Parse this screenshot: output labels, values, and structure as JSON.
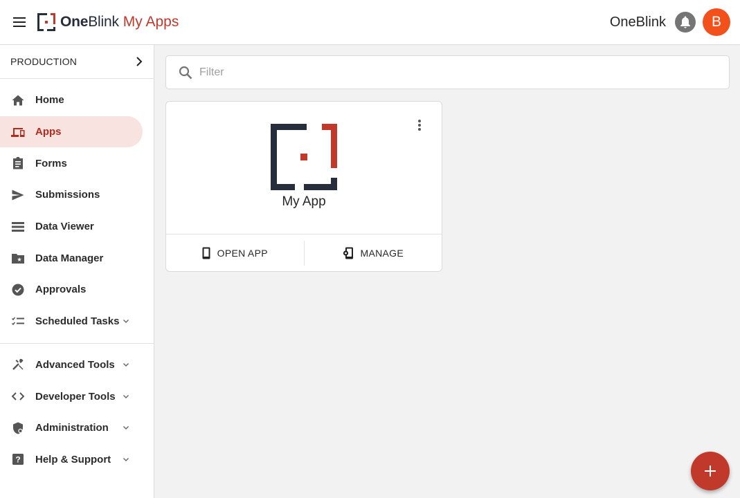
{
  "header": {
    "brand_name_bold": "One",
    "brand_name_light": "Blink",
    "brand_subtitle": "My Apps",
    "organization": "OneBlink",
    "avatar_initial": "B"
  },
  "sidebar": {
    "environment": "PRODUCTION",
    "items": [
      {
        "label": "Home",
        "icon": "home-icon"
      },
      {
        "label": "Apps",
        "icon": "devices-icon",
        "active": true
      },
      {
        "label": "Forms",
        "icon": "clipboard-icon"
      },
      {
        "label": "Submissions",
        "icon": "send-icon"
      },
      {
        "label": "Data Viewer",
        "icon": "list-icon"
      },
      {
        "label": "Data Manager",
        "icon": "folder-star-icon"
      },
      {
        "label": "Approvals",
        "icon": "check-circle-icon"
      },
      {
        "label": "Scheduled Tasks",
        "icon": "checklist-icon",
        "expandable": true
      }
    ],
    "tools": [
      {
        "label": "Advanced Tools",
        "icon": "tools-icon",
        "expandable": true
      },
      {
        "label": "Developer Tools",
        "icon": "code-icon",
        "expandable": true
      },
      {
        "label": "Administration",
        "icon": "admin-shield-icon",
        "expandable": true
      },
      {
        "label": "Help & Support",
        "icon": "help-icon",
        "expandable": true
      }
    ]
  },
  "filter": {
    "placeholder": "Filter"
  },
  "apps": [
    {
      "name": "My App",
      "open_label": "OPEN APP",
      "manage_label": "MANAGE"
    }
  ],
  "colors": {
    "brand_red": "#c0392b",
    "brand_navy": "#262d3b",
    "active_bg": "#f8e3e1",
    "avatar": "#f2511b"
  }
}
